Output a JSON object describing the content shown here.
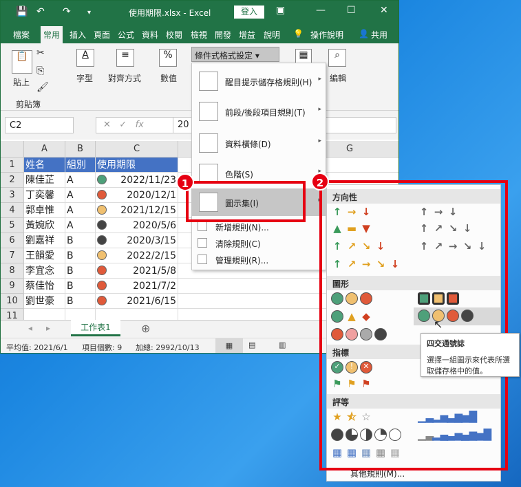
{
  "window": {
    "title": "使用期限.xlsx  -  Excel",
    "login": "登入"
  },
  "tabs": [
    "檔案",
    "常用",
    "插入",
    "頁面",
    "公式",
    "資料",
    "校閱",
    "檢視",
    "開發",
    "增益",
    "說明",
    "操作說明",
    "共用"
  ],
  "ribbon": {
    "paste": "貼上",
    "clipboard": "剪貼簿",
    "font": "字型",
    "align": "對齊方式",
    "number": "數值",
    "cf_button": "條件式格式設定",
    "edit": "編輯"
  },
  "formula": {
    "name_box": "C2",
    "fx": "fx",
    "value": "20"
  },
  "columns": [
    "A",
    "B",
    "C",
    "G"
  ],
  "rows": [
    "1",
    "2",
    "3",
    "4",
    "5",
    "6",
    "7",
    "8",
    "9",
    "10",
    "11"
  ],
  "table": {
    "headers": [
      "姓名",
      "組別",
      "使用期限"
    ],
    "data": [
      {
        "name": "陳佳芷",
        "group": "A",
        "date": "2022/11/23",
        "color": "#4ea07a"
      },
      {
        "name": "丁奕馨",
        "group": "A",
        "date": "2020/12/1",
        "color": "#e05a3a"
      },
      {
        "name": "郭卓惟",
        "group": "A",
        "date": "2021/12/15",
        "color": "#f0c070"
      },
      {
        "name": "黃婉欣",
        "group": "A",
        "date": "2020/5/6",
        "color": "#444444"
      },
      {
        "name": "劉嘉祥",
        "group": "B",
        "date": "2020/3/15",
        "color": "#444444"
      },
      {
        "name": "王韻愛",
        "group": "B",
        "date": "2022/2/15",
        "color": "#f0c070"
      },
      {
        "name": "李宜念",
        "group": "B",
        "date": "2021/5/8",
        "color": "#e05a3a"
      },
      {
        "name": "蔡佳怡",
        "group": "B",
        "date": "2021/7/2",
        "color": "#e05a3a"
      },
      {
        "name": "劉世豪",
        "group": "B",
        "date": "2021/6/15",
        "color": "#e05a3a"
      }
    ]
  },
  "sheet": {
    "tab": "工作表1",
    "add": "⊕"
  },
  "status": {
    "avg": "平均值: 2021/6/1",
    "count": "項目個數: 9",
    "sum": "加總: 2992/10/13"
  },
  "menu": {
    "items": [
      "醒目提示儲存格規則(H)",
      "前段/後段項目規則(T)",
      "資料橫條(D)",
      "色階(S)",
      "圖示集(I)"
    ],
    "small": [
      "新增規則(N)...",
      "清除規則(C)",
      "管理規則(R)..."
    ]
  },
  "submenu": {
    "sections": [
      "方向性",
      "圖形",
      "指標",
      "評等"
    ],
    "more": "其他規則(M)..."
  },
  "badges": [
    "1",
    "2"
  ],
  "tooltip": {
    "title": "四交通號誌",
    "desc": "選擇一組圖示來代表所選取儲存格中的值。"
  }
}
